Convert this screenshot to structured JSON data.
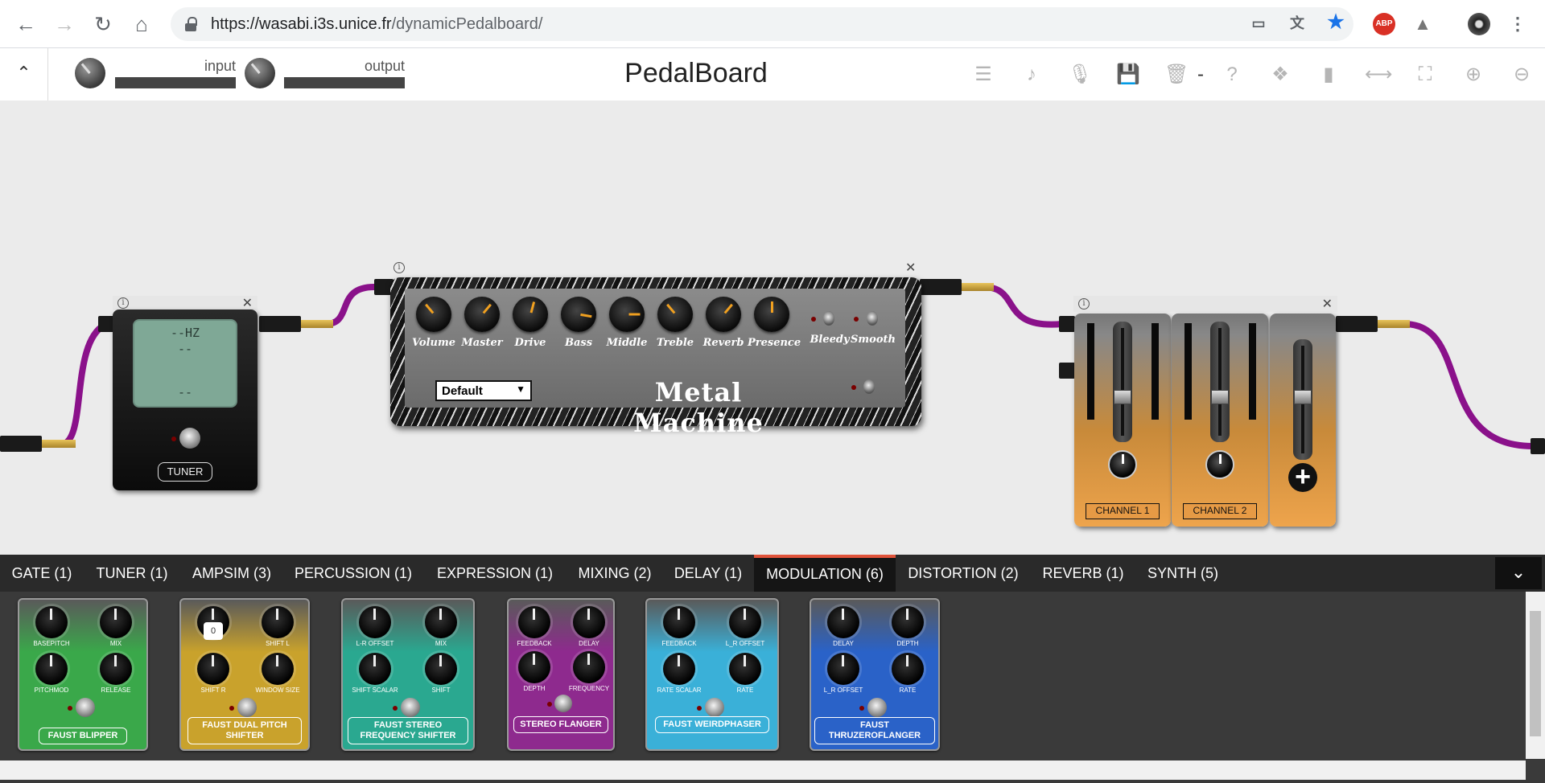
{
  "browser": {
    "url_host": "https://wasabi.i3s.unice.fr",
    "url_path": "/dynamicPedalboard/",
    "abp_label": "ABP"
  },
  "toolbar": {
    "title": "PedalBoard",
    "input_label": "input",
    "output_label": "output",
    "separator": "-"
  },
  "tuner": {
    "line1": "--HZ",
    "line2": "--",
    "line3": "--",
    "label": "TUNER"
  },
  "metal_machine": {
    "title": "Metal Machine",
    "preset": "Default",
    "knobs": [
      "Volume",
      "Master",
      "Drive",
      "Bass",
      "Middle",
      "Treble",
      "Reverb",
      "Presence"
    ],
    "switches": [
      "Bleedy",
      "Smooth"
    ]
  },
  "mixer": {
    "channels": [
      "CHANNEL 1",
      "CHANNEL 2"
    ],
    "add_symbol": "+"
  },
  "categories": [
    {
      "label": "GATE (1)"
    },
    {
      "label": "TUNER (1)"
    },
    {
      "label": "AMPSIM (3)"
    },
    {
      "label": "PERCUSSION (1)"
    },
    {
      "label": "EXPRESSION (1)"
    },
    {
      "label": "MIXING (2)"
    },
    {
      "label": "DELAY (1)"
    },
    {
      "label": "MODULATION (6)"
    },
    {
      "label": "DISTORTION (2)"
    },
    {
      "label": "REVERB (1)"
    },
    {
      "label": "SYNTH (5)"
    }
  ],
  "active_category": "MODULATION (6)",
  "palette": [
    {
      "name": "FAUST BLIPPER",
      "color": "#3aa84a",
      "knobs": [
        "BASEPITCH",
        "MIX",
        "PITCHMOD",
        "RELEASE"
      ]
    },
    {
      "name": "FAUST DUAL PITCH SHIFTER",
      "color": "#c9a22c",
      "knobs": [
        "",
        "SHIFT L",
        "SHIFT R",
        "WINDOW SIZE"
      ],
      "tooltip": "0"
    },
    {
      "name": "FAUST STEREO FREQUENCY SHIFTER",
      "color": "#2aa890",
      "knobs": [
        "L-R OFFSET",
        "MIX",
        "SHIFT SCALAR",
        "SHIFT"
      ]
    },
    {
      "name": "STEREO FLANGER",
      "color": "#8e2a8e",
      "knobs": [
        "FEEDBACK",
        "DELAY",
        "DEPTH",
        "FREQUENCY"
      ]
    },
    {
      "name": "FAUST WEIRDPHASER",
      "color": "#3ab0d8",
      "knobs": [
        "FEEDBACK",
        "L_R OFFSET",
        "RATE SCALAR",
        "RATE"
      ]
    },
    {
      "name": "FAUST THRUZEROFLANGER",
      "color": "#2a62c8",
      "knobs": [
        "DELAY",
        "DEPTH",
        "L_R OFFSET",
        "RATE"
      ]
    }
  ]
}
